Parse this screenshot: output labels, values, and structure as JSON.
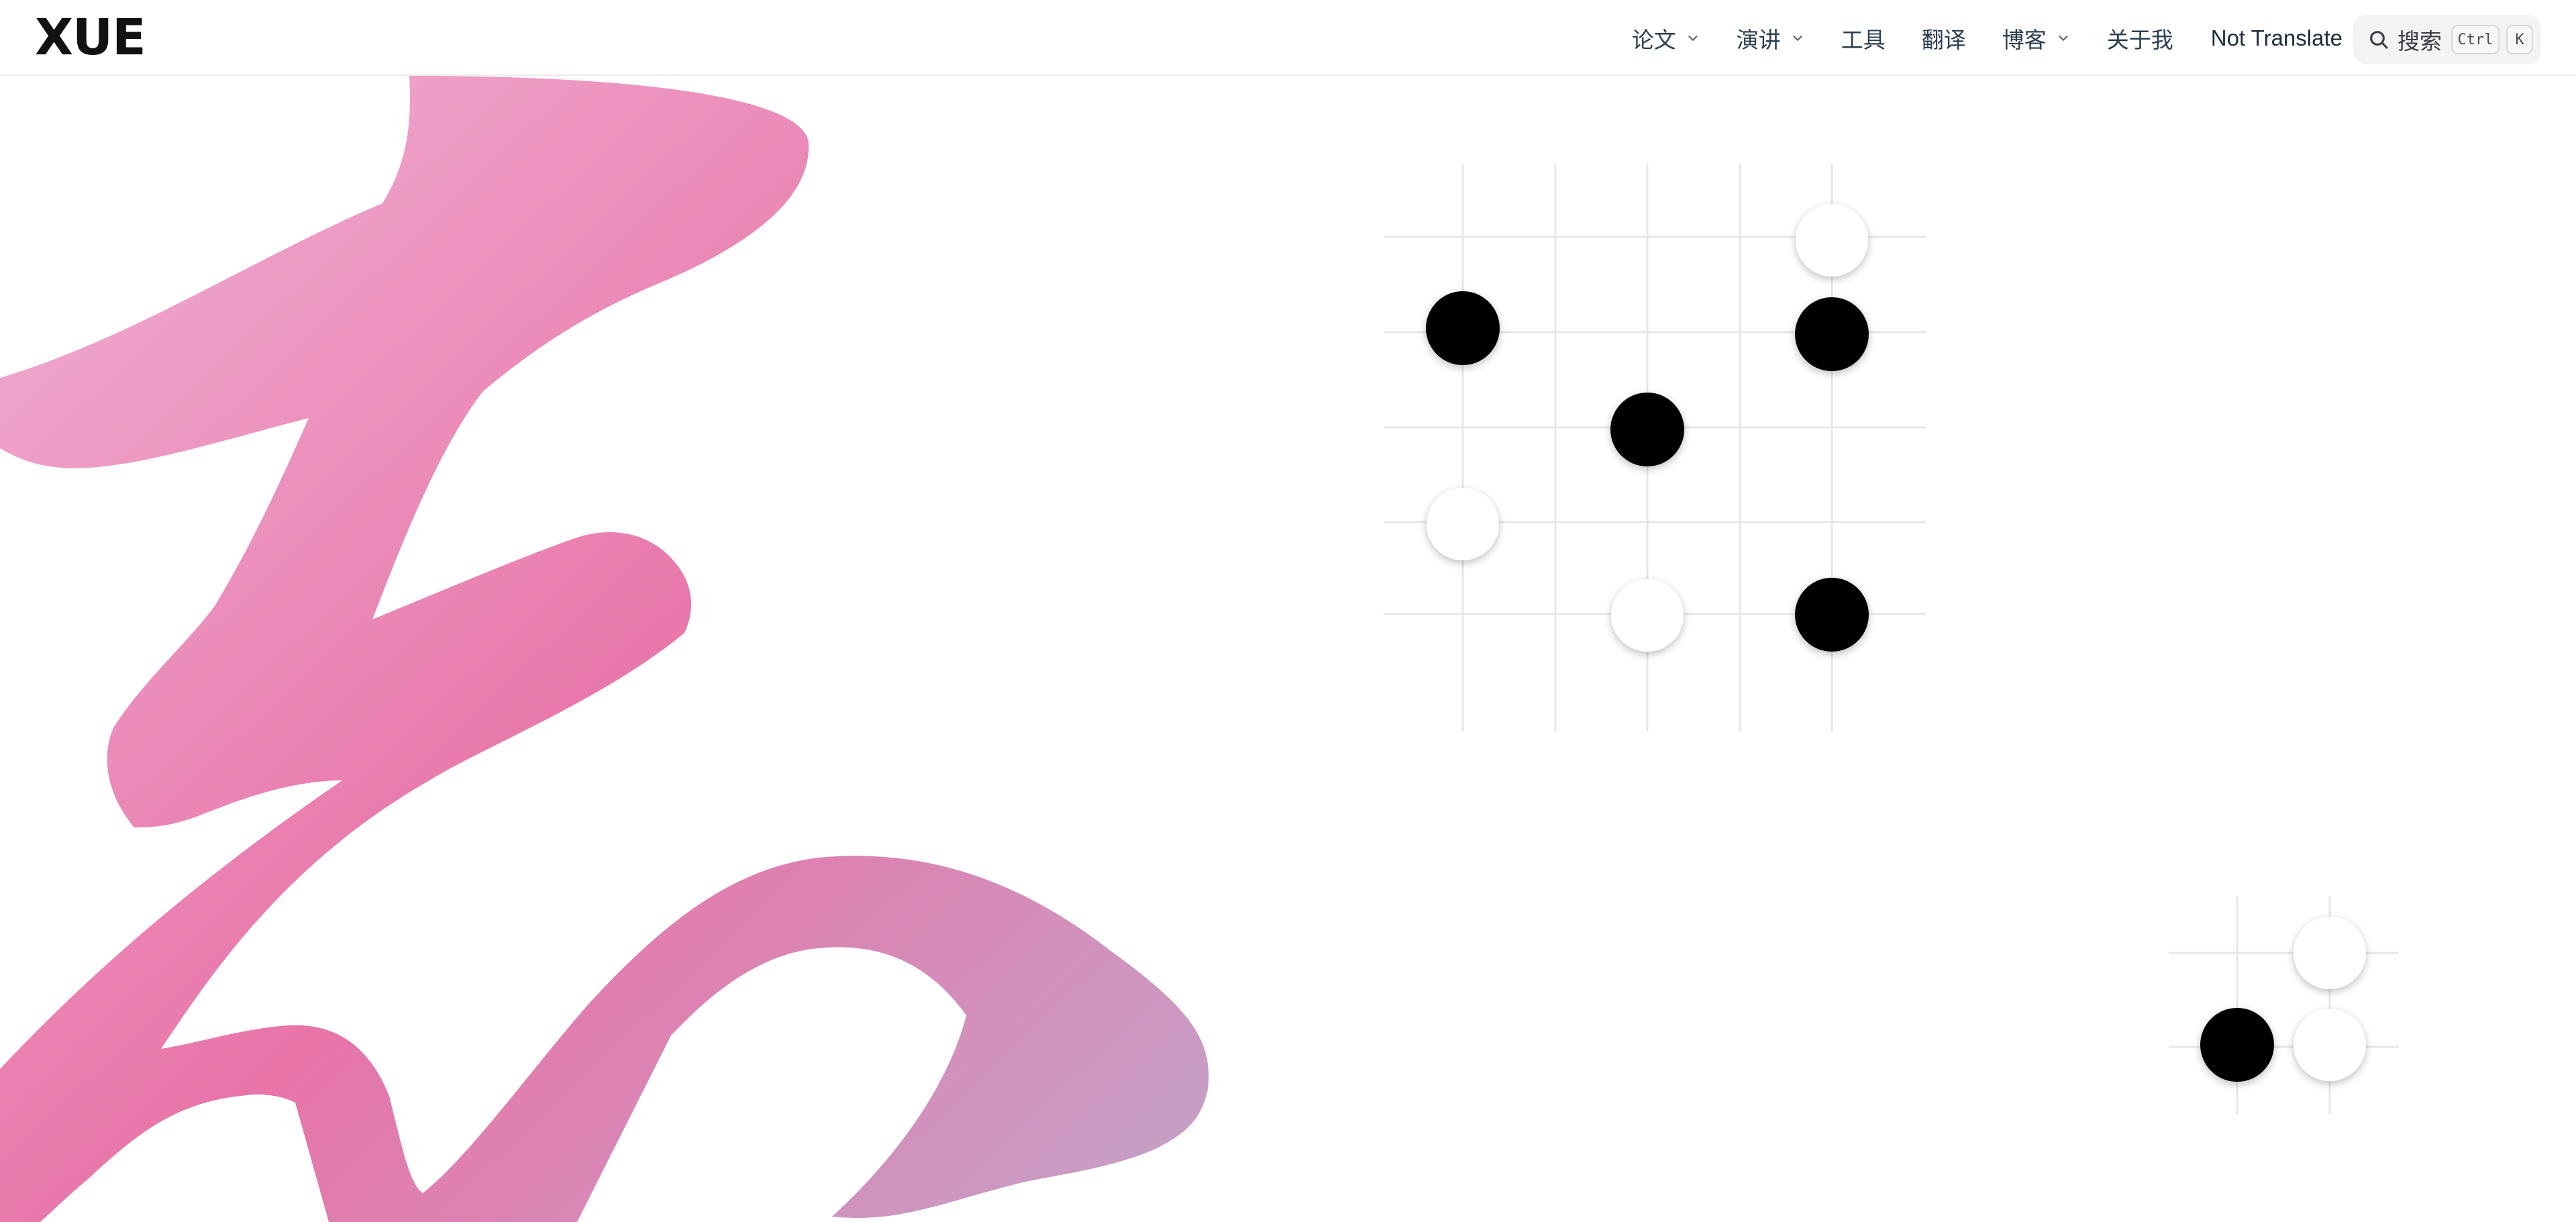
{
  "brand": {
    "logo_text": "XUE"
  },
  "nav": {
    "items": [
      {
        "label": "论文",
        "dropdown": true
      },
      {
        "label": "演讲",
        "dropdown": true
      },
      {
        "label": "工具",
        "dropdown": false
      },
      {
        "label": "翻译",
        "dropdown": false
      },
      {
        "label": "博客",
        "dropdown": true
      },
      {
        "label": "关于我",
        "dropdown": false
      }
    ],
    "language": {
      "label": "Not Translate",
      "dropdown": true
    }
  },
  "search": {
    "label": "搜索",
    "shortcut_ctrl": "Ctrl",
    "shortcut_key": "K",
    "icon": "search-icon"
  },
  "colors": {
    "ink_gradient_start": "#f0b3d5",
    "ink_gradient_mid": "#e874a8",
    "ink_gradient_end": "#c3a3c8",
    "black_stone": "#000000",
    "white_stone": "#ffffff",
    "grid_line": "#e6e6e6"
  }
}
